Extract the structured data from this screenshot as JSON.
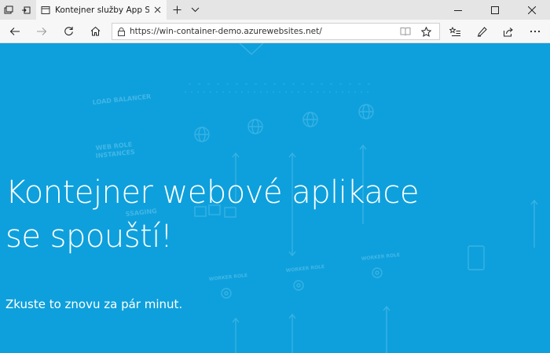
{
  "browser": {
    "tab": {
      "title": "Kontejner služby App Service"
    },
    "address": {
      "url": "https://win-container-demo.azurewebsites.net/"
    },
    "icons": {
      "tab_actions": "tab-actions-icon",
      "set_aside": "set-aside-tabs-icon",
      "page": "page-icon",
      "close_tab": "close-icon",
      "new_tab": "plus-icon",
      "tab_list": "chevron-down-icon",
      "minimize": "minimize-icon",
      "maximize": "maximize-icon",
      "close_window": "close-window-icon",
      "back": "back-arrow-icon",
      "forward": "forward-arrow-icon",
      "refresh": "refresh-icon",
      "home": "home-icon",
      "lock": "lock-icon",
      "reading_view": "reading-view-icon",
      "favorite": "star-icon",
      "favorites_hub": "favorites-hub-icon",
      "notes": "pen-icon",
      "share": "share-icon",
      "more": "more-icon"
    }
  },
  "page": {
    "headline_line1": "Kontejner webové aplikace",
    "headline_line2": "se spouští!",
    "subtext": "Zkuste to znovu za pár minut.",
    "background_color": "#0ea0dc",
    "watermark_labels": {
      "load_balancer": "LOAD BALANCER",
      "web_role_1": "WEB ROLE",
      "web_role_2": "INSTANCES",
      "messaging": "SSAGING",
      "worker_role": "WORKER ROLE"
    }
  }
}
